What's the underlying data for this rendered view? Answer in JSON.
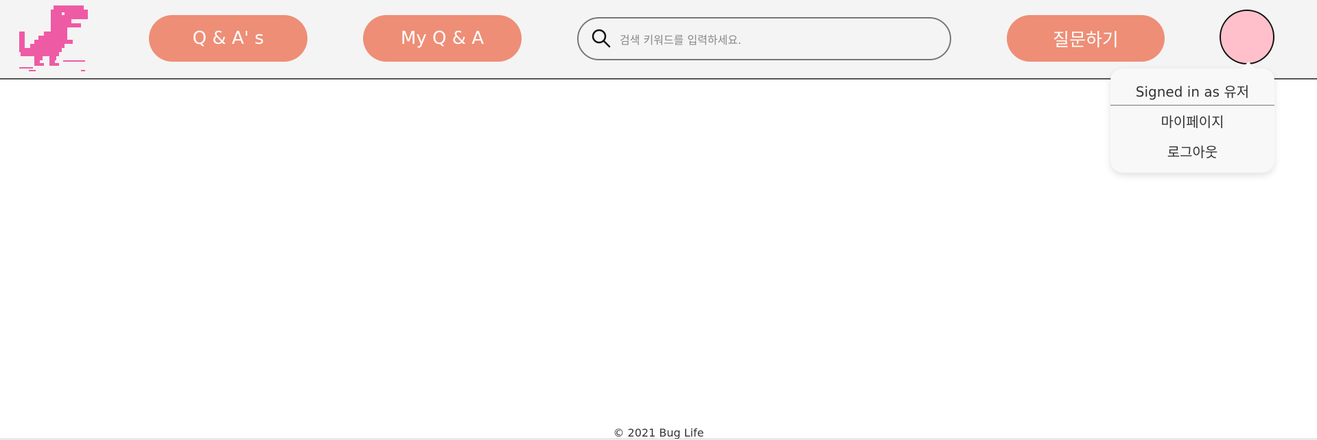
{
  "header": {
    "logo_name": "pink-dinosaur-logo",
    "nav": {
      "qas_label": "Q & A' s",
      "my_qa_label": "My Q & A"
    },
    "search": {
      "placeholder": "검색 키워드를 입력하세요.",
      "value": ""
    },
    "ask_label": "질문하기"
  },
  "user_menu": {
    "signed_in_text": "Signed in as 유저",
    "items": [
      {
        "label": "마이페이지"
      },
      {
        "label": "로그아웃"
      }
    ]
  },
  "footer": {
    "text": "© 2021 Bug Life"
  },
  "colors": {
    "accent": "#ee8e76",
    "logo": "#ef5aa4",
    "avatar": "#ffc0cb",
    "header_bg": "#f4f4f4"
  }
}
